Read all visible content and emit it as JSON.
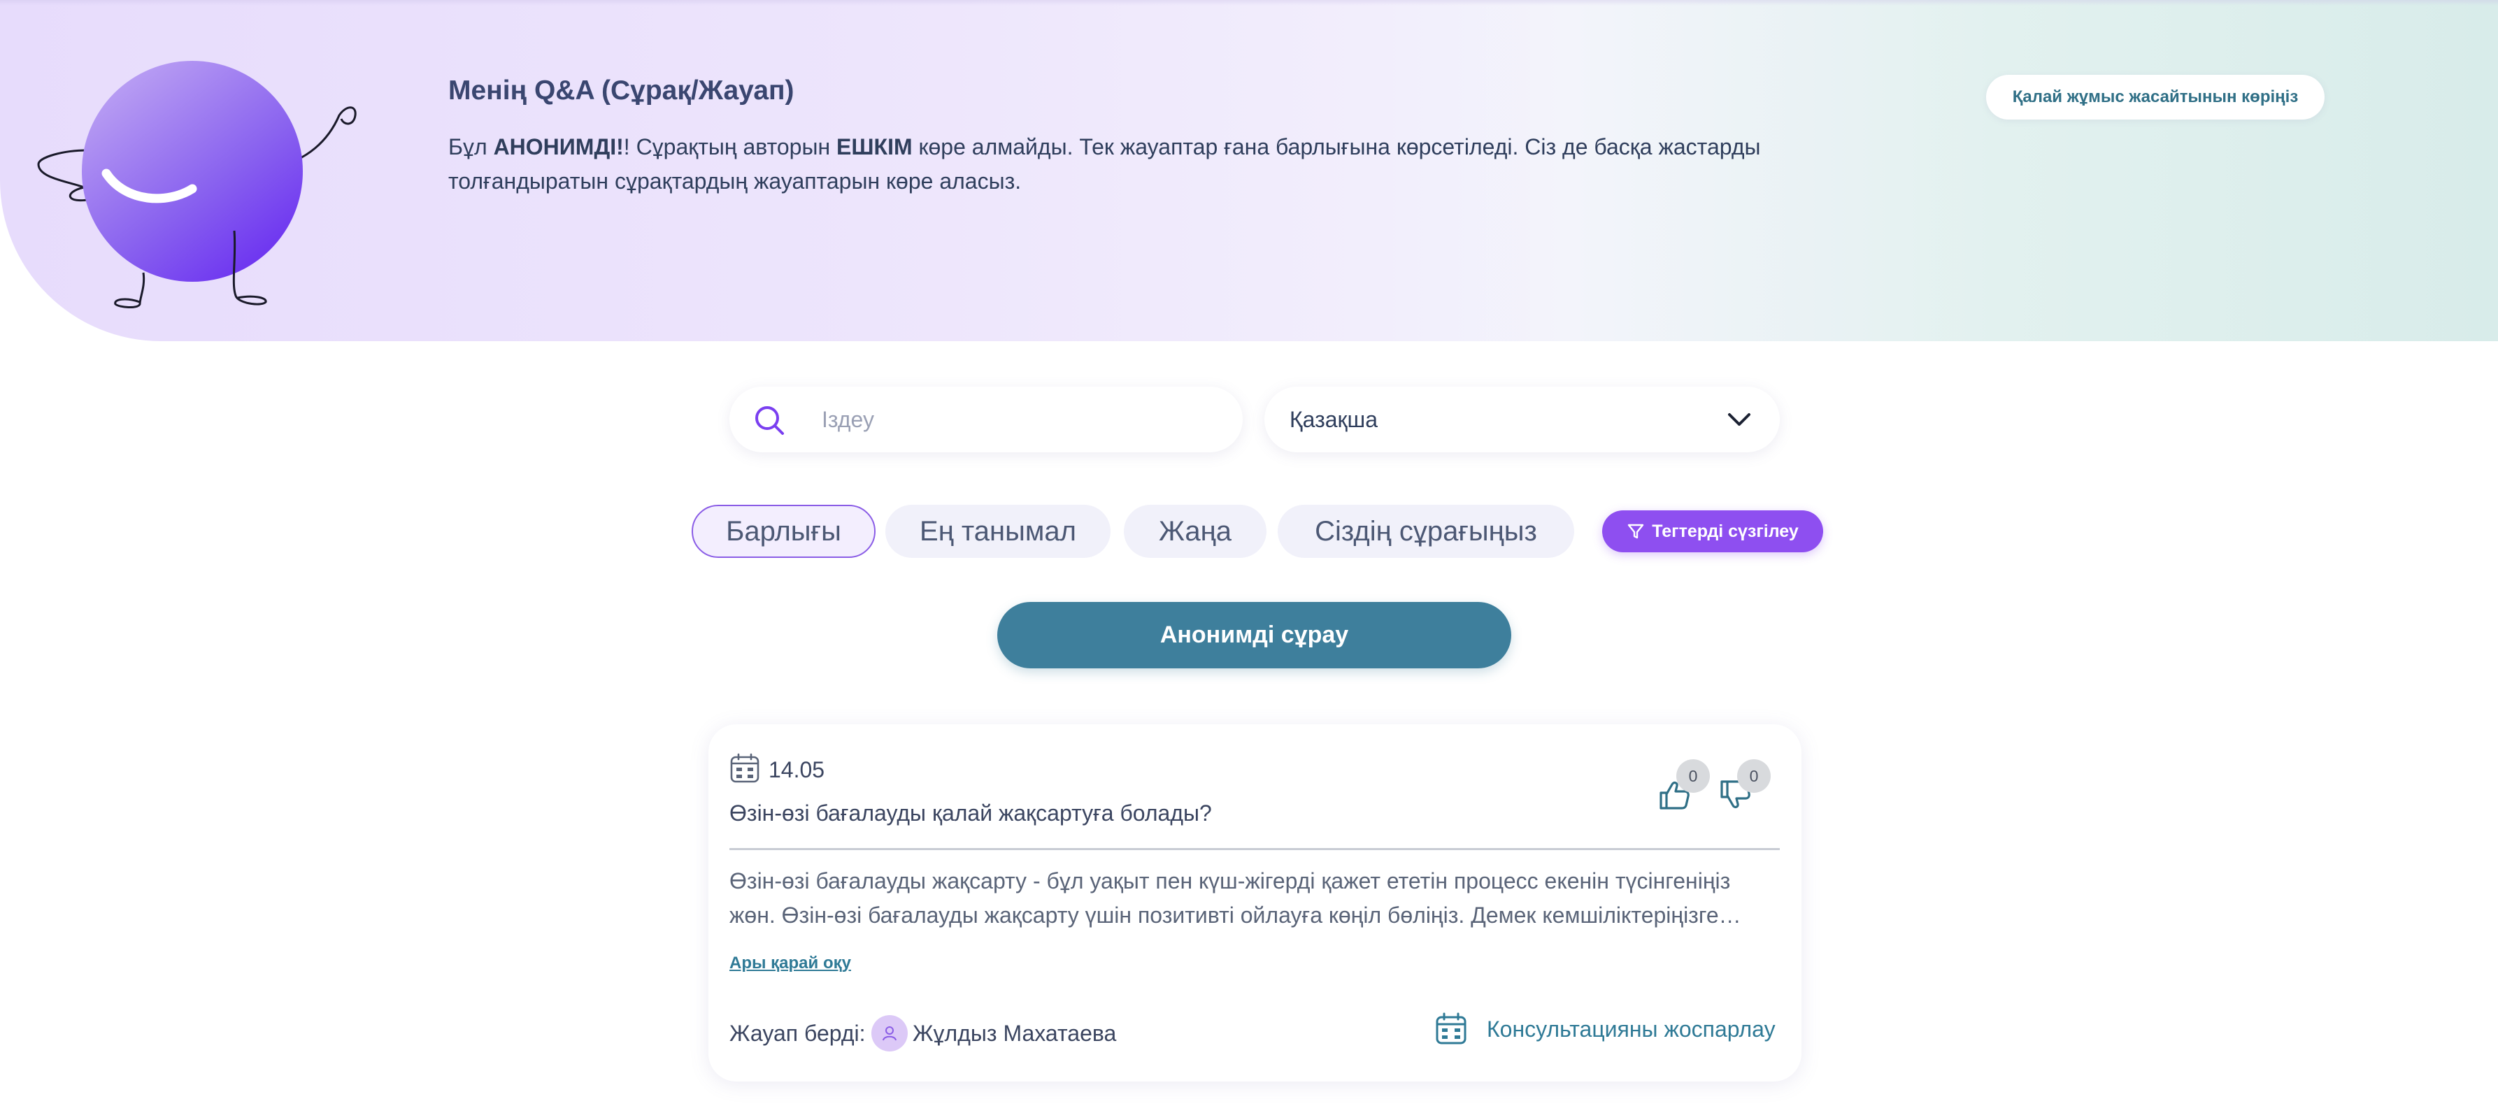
{
  "hero": {
    "title": "Менің Q&A (Сұрақ/Жауап)",
    "text_prefix": "Бұл ",
    "text_anon": "АНОНИМДІ!",
    "text_mid1": "! Сұрақтың авторын ",
    "text_nobody": "ЕШКІМ",
    "text_rest": " көре алмайды. Тек жауаптар ғана барлығына көрсетіледі. Сіз де басқа жастарды толғандыратын сұрақтардың жауаптарын көре аласыз.",
    "how_button": "Қалай жұмыс жасайтынын көріңіз",
    "mascot_icon": "smiling-purple-ball-mascot"
  },
  "search": {
    "placeholder": "Іздеу",
    "value": "",
    "icon": "search-icon"
  },
  "language": {
    "selected": "Қазақша",
    "icon": "chevron-down-icon"
  },
  "tabs": [
    {
      "label": "Барлығы",
      "active": true
    },
    {
      "label": "Ең танымал",
      "active": false
    },
    {
      "label": "Жаңа",
      "active": false
    },
    {
      "label": "Сіздің сұрағыңыз",
      "active": false
    }
  ],
  "tags_button": "Тегтерді сүзгілеу",
  "ask_button": "Анонимді сұрау",
  "card": {
    "date": "14.05",
    "question": "Өзін-өзі бағалауды қалай жақсартуға болады?",
    "likes": "0",
    "dislikes": "0",
    "answer": "Өзін-өзі бағалауды жақсарту - бұл уақыт пен күш-жігерді қажет ететін процесс екенін түсінгеніңіз жөн. Өзін-өзі бағалауды жақсарту үшін позитивті ойлауға көңіл бөліңіз. Демек кемшіліктеріңізге…",
    "read_more": "Ары қарай оқу",
    "answered_by_label": "Жауап берді:",
    "answerer": "Жұлдыз Махатаева",
    "consult_label": "Консультацияны жоспарлау"
  },
  "colors": {
    "accent_purple": "#8e4ff0",
    "teal_button": "#3e7f9c",
    "link_teal": "#2f7a96",
    "text_dark": "#2f3e5c"
  }
}
